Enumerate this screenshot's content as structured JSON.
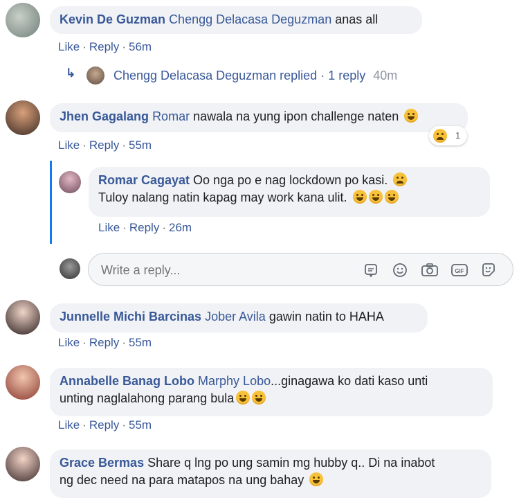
{
  "comments": [
    {
      "author": "Kevin De Guzman",
      "mention": "Chengg Delacasa Deguzman",
      "text": " anas all",
      "like": "Like",
      "reply": "Reply",
      "time": "56m"
    },
    {
      "author": "Jhen Gagalang",
      "mention": "Romar",
      "text": " nawala na yung ipon challenge naten ",
      "like": "Like",
      "reply": "Reply",
      "time": "55m",
      "reaction_count": "1"
    },
    {
      "author": "Junnelle Michi Barcinas",
      "mention": "Jober Avila",
      "text": " gawin natin to HAHA",
      "like": "Like",
      "reply": "Reply",
      "time": "55m"
    },
    {
      "author": "Annabelle Banag Lobo",
      "mention": "Marphy Lobo",
      "text1": "...ginagawa ko dati kaso unti",
      "text2": "unting naglalahong parang bula",
      "like": "Like",
      "reply": "Reply",
      "time": "55m"
    },
    {
      "author": "Grace Bermas",
      "text1": " Share q lng po ung samin mg hubby q.. Di na inabot",
      "text2": "ng dec need na para matapos na ung bahay "
    }
  ],
  "replies_summary": {
    "name": "Chengg Delacasa Deguzman replied",
    "sep": "·",
    "count": "1 reply",
    "time": "40m"
  },
  "nested_reply": {
    "author": "Romar Cagayat",
    "text1": " Oo nga po e nag lockdown po kasi. ",
    "text2": "Tuloy nalang natin kapag may work kana ulit. ",
    "like": "Like",
    "reply": "Reply",
    "time": "26m"
  },
  "reply_box": {
    "placeholder": "Write a reply...",
    "icons": [
      "sticker-icon",
      "emoji-icon",
      "camera-icon",
      "gif-icon",
      "sticker-face-icon"
    ]
  },
  "dot": "·",
  "colors": {
    "bubble": "#f0f2f5",
    "link": "#385898",
    "thread_line": "#1877f2"
  }
}
